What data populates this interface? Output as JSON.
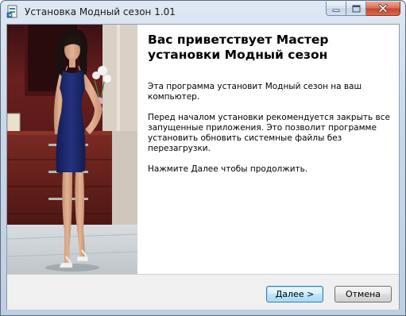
{
  "window": {
    "title": "Установка Модный сезон 1.01"
  },
  "welcome": {
    "heading": "Вас приветствует Мастер установки Модный сезон",
    "paragraphs": [
      "Эта программа установит Модный сезон на ваш компьютер.",
      "Перед началом установки рекомендуется закрыть все запущенные приложения. Это позволит программе установить обновить системные файлы без перезагрузки.",
      "Нажмите Далее чтобы продолжить."
    ]
  },
  "buttons": {
    "next_label": "Далее >",
    "cancel_label": "Отмена"
  },
  "colors": {
    "accent": "#3c7fb1",
    "dress": "#1e2a6e",
    "background_wall": "#6b1f1f"
  },
  "icons": {
    "app": "installer-icon",
    "minimize": "minimize-icon",
    "maximize": "maximize-icon",
    "close": "close-icon"
  }
}
